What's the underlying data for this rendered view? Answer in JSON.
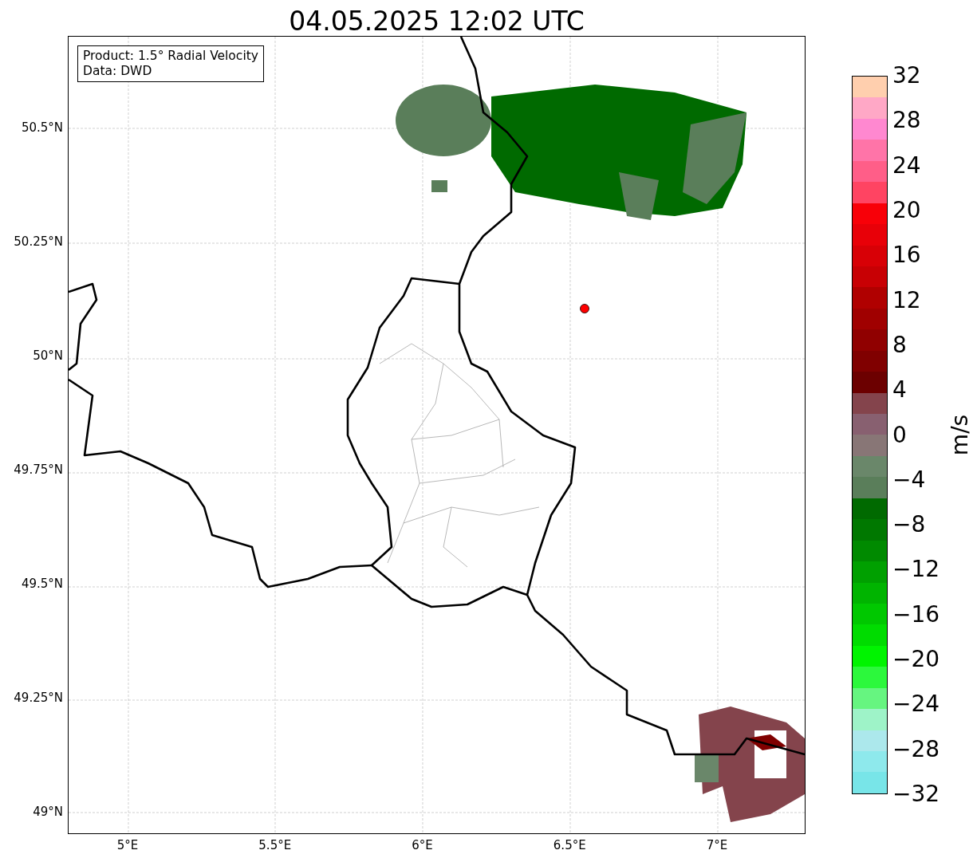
{
  "title": "04.05.2025 12:02 UTC",
  "info_box": {
    "lines": [
      "Product: 1.5° Radial Velocity",
      "Data: DWD"
    ]
  },
  "map": {
    "x_ticks": [
      "5°E",
      "5.5°E",
      "6°E",
      "6.5°E",
      "7°E"
    ],
    "y_ticks": [
      "50.5°N",
      "50.25°N",
      "50°N",
      "49.75°N",
      "49.5°N",
      "49.25°N",
      "49°N"
    ]
  },
  "colorbar": {
    "label": "m/s",
    "ticks": [
      "32",
      "28",
      "24",
      "20",
      "16",
      "12",
      "8",
      "4",
      "0",
      "−4",
      "−8",
      "−12",
      "−16",
      "−20",
      "−24",
      "−28",
      "−32"
    ],
    "bands": [
      {
        "color": "#ffcfae"
      },
      {
        "color": "#ffa8c6"
      },
      {
        "color": "#ff88d0"
      },
      {
        "color": "#ff74a8"
      },
      {
        "color": "#ff5e88"
      },
      {
        "color": "#ff4462"
      },
      {
        "color": "#f80008"
      },
      {
        "color": "#e80008"
      },
      {
        "color": "#d80006"
      },
      {
        "color": "#c80004"
      },
      {
        "color": "#b00000"
      },
      {
        "color": "#a00000"
      },
      {
        "color": "#900000"
      },
      {
        "color": "#800000"
      },
      {
        "color": "#6c0000"
      },
      {
        "color": "#84444c"
      },
      {
        "color": "#886070"
      },
      {
        "color": "#887676"
      },
      {
        "color": "#6a876a"
      },
      {
        "color": "#5a7e5a"
      },
      {
        "color": "#006a00"
      },
      {
        "color": "#007800"
      },
      {
        "color": "#008a00"
      },
      {
        "color": "#00a000"
      },
      {
        "color": "#00b400"
      },
      {
        "color": "#00c800"
      },
      {
        "color": "#00dc00"
      },
      {
        "color": "#00f400"
      },
      {
        "color": "#2cf83c"
      },
      {
        "color": "#66f580"
      },
      {
        "color": "#9ef3c8"
      },
      {
        "color": "#ace8ec"
      },
      {
        "color": "#8ee9ec"
      },
      {
        "color": "#78e5e8"
      }
    ]
  }
}
